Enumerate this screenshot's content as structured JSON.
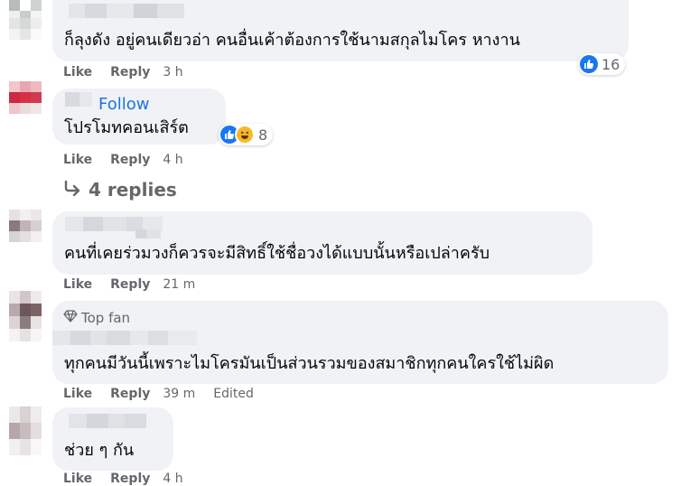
{
  "comments": [
    {
      "text": "ก็ลุงดัง อยู่คนเดียวอ่า คนอื่นเค้าต้องการใช้นามสกุลไมโคร หางาน",
      "like": "Like",
      "reply": "Reply",
      "time": "3 h",
      "reaction_count": "16"
    },
    {
      "follow": "Follow",
      "text": "โปรโมทคอนเสิร์ต",
      "like": "Like",
      "reply": "Reply",
      "time": "4 h",
      "reaction_count": "8",
      "replies_label": "4 replies"
    },
    {
      "text": "คนที่เคยร่วมวงก็ควรจะมีสิทธิ์ใช้ชื่อวงได้แบบนั้นหรือเปล่าครับ",
      "like": "Like",
      "reply": "Reply",
      "time": "21 m"
    },
    {
      "badge": "Top fan",
      "text": "ทุกคนมีวันนี้เพราะไมโครมันเป็นส่วนรวมของสมาชิกทุกคนใครใช้ไม่ผิด",
      "like": "Like",
      "reply": "Reply",
      "time": "39 m",
      "edited": "Edited"
    },
    {
      "text": "ช่วย ๆ กัน",
      "like": "Like",
      "reply": "Reply",
      "time": "4 h"
    }
  ],
  "colors": {
    "bubble": "#f0f2f5",
    "meta_text": "#65676b",
    "follow_blue": "#1b74e4",
    "like_blue": "#1877f2",
    "haha_yellow": "#f7b928"
  },
  "icons": {
    "reply_arrow": "reply-arrow-icon",
    "like": "like-reaction-icon",
    "haha": "haha-reaction-icon",
    "top_fan": "diamond-icon"
  }
}
